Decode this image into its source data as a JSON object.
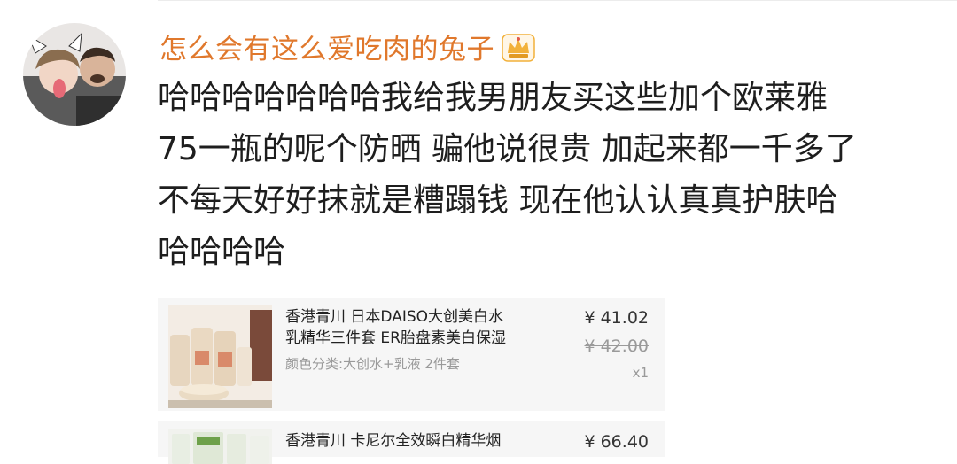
{
  "comment": {
    "username": "怎么会有这么爱吃肉的兔子",
    "lines": [
      "哈哈哈哈哈哈哈我给我男朋友买这些加个欧莱雅",
      "75一瓶的呢个防晒 骗他说很贵 加起来都一千多了",
      "不每天好好抹就是糟蹋钱 现在他认认真真护肤哈",
      "哈哈哈哈"
    ]
  },
  "orders": [
    {
      "title_lines": [
        "香港青川 日本DAISO大创美白水",
        "乳精华三件套 ER胎盘素美白保湿"
      ],
      "variant": "颜色分类:大创水+乳液 2件套",
      "price": "¥ 41.02",
      "original_price": "¥ 42.00",
      "quantity": "x1"
    },
    {
      "title_lines": [
        "香港青川 卡尼尔全效瞬白精华烟"
      ],
      "price": "¥ 66.40"
    }
  ],
  "colors": {
    "username": "#e0782c",
    "crown": "#f2b13a"
  },
  "icons": {
    "badge": "crown-icon"
  }
}
